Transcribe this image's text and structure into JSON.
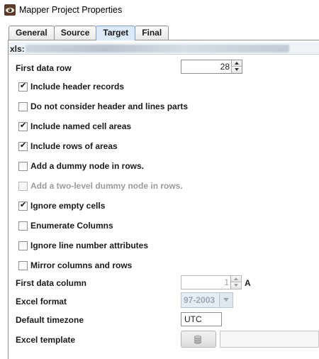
{
  "window": {
    "title": "Mapper Project Properties"
  },
  "tabs": [
    {
      "label": "General"
    },
    {
      "label": "Source"
    },
    {
      "label": "Target"
    },
    {
      "label": "Final"
    }
  ],
  "active_tab": "Target",
  "xls": {
    "label": "xls:"
  },
  "first_data_row": {
    "label": "First data row",
    "value": "28"
  },
  "options": [
    {
      "label": "Include header records",
      "checked": true,
      "enabled": true
    },
    {
      "label": "Do not consider header and lines parts",
      "checked": false,
      "enabled": true
    },
    {
      "label": "Include named cell areas",
      "checked": true,
      "enabled": true
    },
    {
      "label": "Include rows of areas",
      "checked": true,
      "enabled": true
    },
    {
      "label": "Add a dummy node in rows.",
      "checked": false,
      "enabled": true
    },
    {
      "label": "Add a two-level dummy node in rows.",
      "checked": false,
      "enabled": false
    },
    {
      "label": "Ignore empty cells",
      "checked": true,
      "enabled": true
    },
    {
      "label": "Enumerate Columns",
      "checked": false,
      "enabled": true
    },
    {
      "label": "Ignore line number attributes",
      "checked": false,
      "enabled": true
    },
    {
      "label": "Mirror columns and rows",
      "checked": false,
      "enabled": true
    }
  ],
  "first_data_column": {
    "label": "First data column",
    "value": "1",
    "column_letter": "A"
  },
  "excel_format": {
    "label": "Excel format",
    "value": "97-2003"
  },
  "default_timezone": {
    "label": "Default timezone",
    "value": "UTC"
  },
  "excel_template": {
    "label": "Excel template",
    "button_icon": "database-icon"
  }
}
